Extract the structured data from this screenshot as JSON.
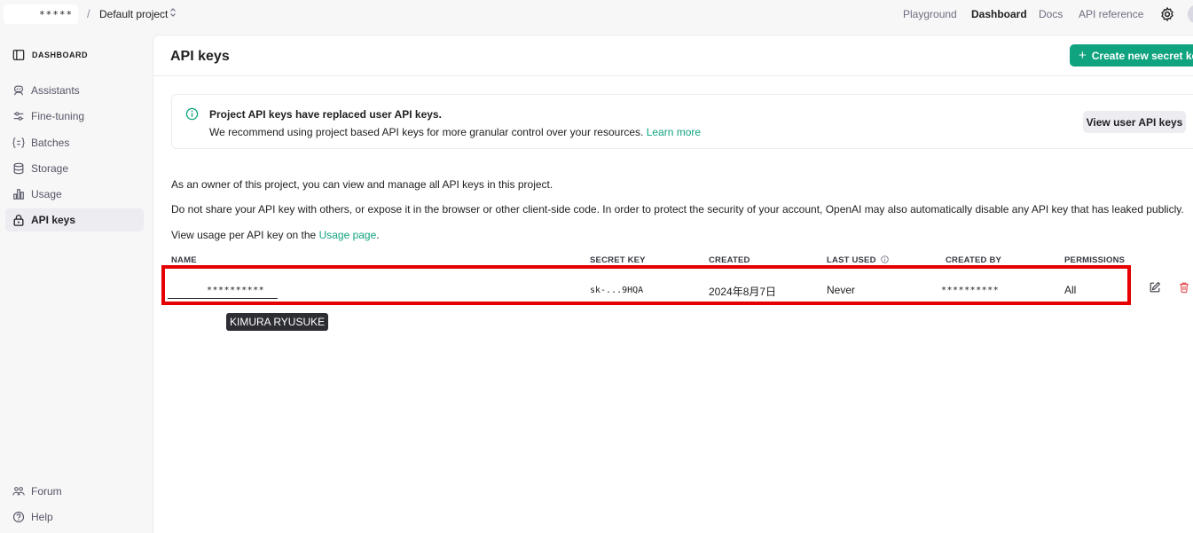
{
  "topbar": {
    "org_name": "*****",
    "separator": "/",
    "project_name": "Default project",
    "nav": [
      "Playground",
      "Dashboard",
      "Docs",
      "API reference"
    ],
    "active_nav": "Dashboard"
  },
  "sidebar": {
    "heading": "DASHBOARD",
    "items": [
      {
        "label": "Assistants",
        "icon": "assistant-icon"
      },
      {
        "label": "Fine-tuning",
        "icon": "sliders-icon"
      },
      {
        "label": "Batches",
        "icon": "batches-icon"
      },
      {
        "label": "Storage",
        "icon": "database-icon"
      },
      {
        "label": "Usage",
        "icon": "bar-chart-icon"
      },
      {
        "label": "API keys",
        "icon": "lock-icon",
        "active": true
      }
    ],
    "footer": [
      {
        "label": "Forum",
        "icon": "people-icon"
      },
      {
        "label": "Help",
        "icon": "help-icon"
      }
    ]
  },
  "main": {
    "title": "API keys",
    "create_button": "Create new secret key",
    "notice": {
      "title": "Project API keys have replaced user API keys.",
      "text": "We recommend using project based API keys for more granular control over your resources.",
      "link": "Learn more",
      "button": "View user API keys"
    },
    "paragraphs": {
      "p1": "As an owner of this project, you can view and manage all API keys in this project.",
      "p2": "Do not share your API key with others, or expose it in the browser or other client-side code. In order to protect the security of your account, OpenAI may also automatically disable any API key that has leaked publicly.",
      "p3_prefix": "View usage per API key on the",
      "p3_link": "Usage page",
      "p3_suffix": "."
    },
    "table": {
      "headers": {
        "name": "NAME",
        "secret_key": "SECRET KEY",
        "created": "CREATED",
        "last_used": "LAST USED",
        "created_by": "CREATED BY",
        "permissions": "PERMISSIONS"
      },
      "rows": [
        {
          "name": "**********",
          "secret_key": "sk-...9HQA",
          "created": "2024年8月7日",
          "last_used": "Never",
          "created_by": "**********",
          "permissions": "All"
        }
      ]
    },
    "tooltip": "KIMURA RYUSUKE"
  },
  "colors": {
    "accent": "#10a37f",
    "highlight": "#e60000",
    "delete": "#e5484d"
  }
}
